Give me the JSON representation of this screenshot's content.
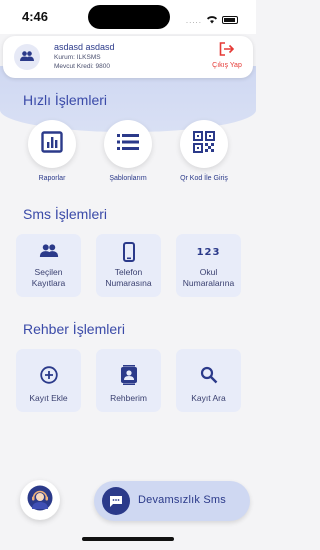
{
  "status": {
    "time": "4:46",
    "dots": "....."
  },
  "user": {
    "name": "asdasd asdasd",
    "institution": "Kurum: ILKSMS",
    "credit": "Mevcut Kredi: 9800",
    "logout_label": "Çıkış Yap"
  },
  "quick": {
    "title": "Hızlı İşlemleri",
    "items": [
      {
        "label": "Raporlar",
        "icon": "report-chart-icon"
      },
      {
        "label": "Şablonlarım",
        "icon": "list-icon"
      },
      {
        "label": "Qr Kod İle Giriş",
        "icon": "qr-code-icon"
      }
    ]
  },
  "sms": {
    "title": "Sms İşlemleri",
    "items": [
      {
        "label_line1": "Seçilen",
        "label_line2": "Kayıtlara",
        "icon": "people-icon"
      },
      {
        "label_line1": "Telefon",
        "label_line2": "Numarasına",
        "icon": "phone-icon"
      },
      {
        "label_line1": "Okul",
        "label_line2": "Numaralarına",
        "icon": "numbers-icon",
        "icon_text": "123"
      }
    ]
  },
  "contacts": {
    "title": "Rehber İşlemleri",
    "items": [
      {
        "label": "Kayıt Ekle",
        "icon": "add-circle-icon"
      },
      {
        "label": "Rehberim",
        "icon": "contact-book-icon"
      },
      {
        "label": "Kayıt Ara",
        "icon": "search-icon"
      }
    ]
  },
  "bottom": {
    "absence_label": "Devamsızlık Sms",
    "support_icon": "support-agent-icon"
  },
  "colors": {
    "primary": "#2b3a8a",
    "accent_band": "#cfd8f2",
    "tile_bg": "#e8ecf9",
    "logout": "#e53935"
  }
}
